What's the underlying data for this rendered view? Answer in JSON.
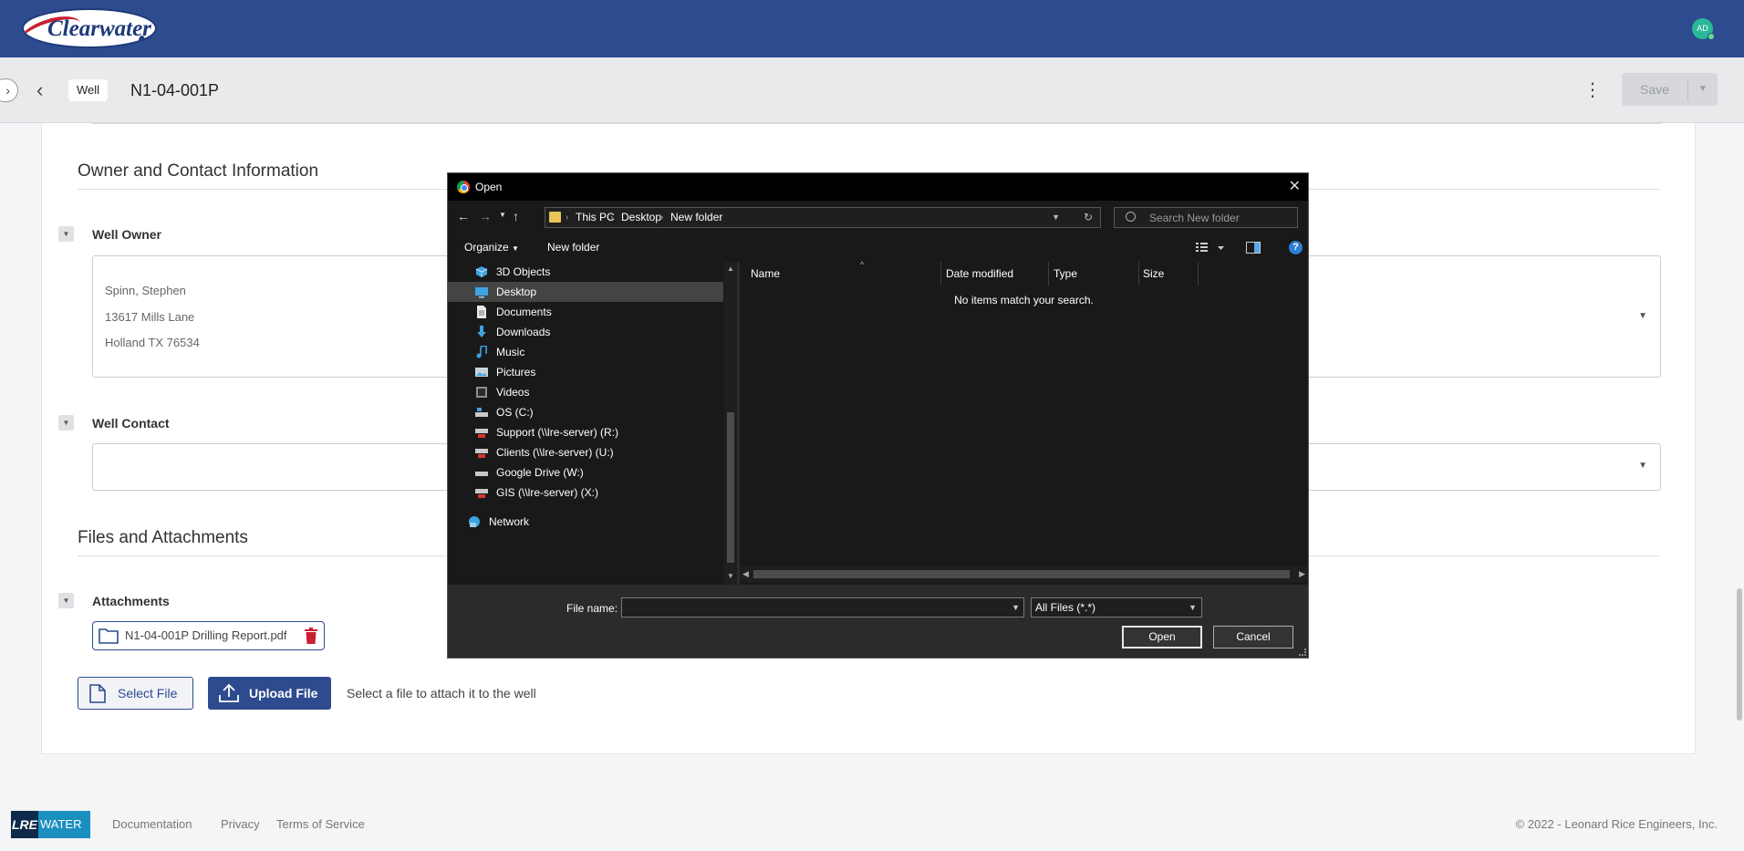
{
  "app": {
    "logo_text": "Clearwater",
    "avatar_initials": "AD",
    "colors": {
      "header": "#2d4b8e",
      "brand_red": "#c8202f",
      "avatar": "#29b89a",
      "dialog_bg": "#2b2b2b",
      "accent": "#2d4b8e"
    }
  },
  "subheader": {
    "expand_icon": "chevron-right-icon",
    "back_icon": "chevron-left-icon",
    "type_chip": "Well",
    "title": "N1-04-001P",
    "menu_icon": "kebab-icon",
    "save_label": "Save",
    "save_menu_icon": "caret-down-icon"
  },
  "sections": {
    "owner_contact": {
      "title": "Owner and Contact Information",
      "well_owner": {
        "label": "Well Owner",
        "lines": [
          "Spinn, Stephen",
          "13617 Mills Lane",
          "Holland TX 76534"
        ]
      },
      "well_contact": {
        "label": "Well Contact",
        "value": ""
      }
    },
    "files": {
      "title": "Files and Attachments",
      "attachments_label": "Attachments",
      "attachment_name": "N1-04-001P Drilling Report.pdf",
      "select_file_label": "Select File",
      "upload_file_label": "Upload File",
      "hint": "Select a file to attach it to the well"
    }
  },
  "footer": {
    "logo_left": "LRE",
    "logo_right": "WATER",
    "links": [
      "Documentation",
      "Privacy",
      "Terms of Service"
    ],
    "copyright": "© 2022 - Leonard Rice Engineers, Inc."
  },
  "dialog": {
    "title": "Open",
    "breadcrumb": [
      "This PC",
      "Desktop",
      "New folder"
    ],
    "search_placeholder": "Search New folder",
    "organize_label": "Organize",
    "new_folder_label": "New folder",
    "help_label": "?",
    "tree": [
      {
        "label": "3D Objects",
        "icon": "3d-objects-icon"
      },
      {
        "label": "Desktop",
        "icon": "desktop-icon",
        "selected": true
      },
      {
        "label": "Documents",
        "icon": "documents-icon"
      },
      {
        "label": "Downloads",
        "icon": "downloads-icon"
      },
      {
        "label": "Music",
        "icon": "music-icon"
      },
      {
        "label": "Pictures",
        "icon": "pictures-icon"
      },
      {
        "label": "Videos",
        "icon": "videos-icon"
      },
      {
        "label": "OS (C:)",
        "icon": "drive-icon"
      },
      {
        "label": "Support (\\\\lre-server) (R:)",
        "icon": "network-drive-icon"
      },
      {
        "label": "Clients (\\\\lre-server) (U:)",
        "icon": "network-drive-icon"
      },
      {
        "label": "Google Drive (W:)",
        "icon": "drive-icon"
      },
      {
        "label": "GIS (\\\\lre-server) (X:)",
        "icon": "network-drive-icon"
      },
      {
        "label": "Network",
        "icon": "network-icon"
      }
    ],
    "columns": [
      "Name",
      "Date modified",
      "Type",
      "Size"
    ],
    "empty_message": "No items match your search.",
    "file_name_label": "File name:",
    "file_name_value": "",
    "filter_value": "All Files (*.*)",
    "open_label": "Open",
    "cancel_label": "Cancel"
  }
}
